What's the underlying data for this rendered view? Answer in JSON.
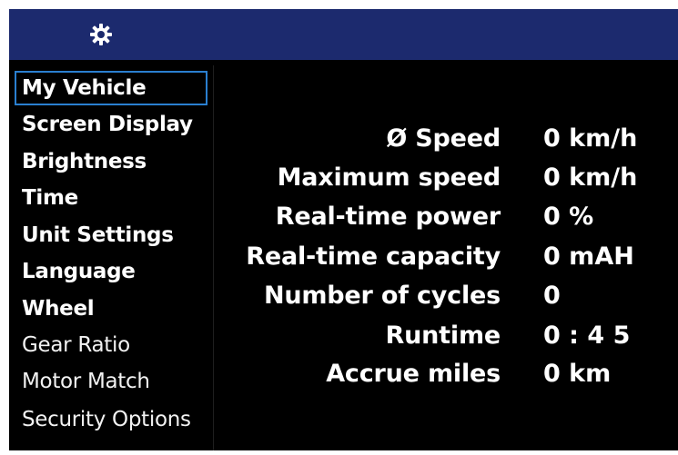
{
  "header": {
    "icon": "gear-icon",
    "color": "#1c2a6e"
  },
  "sidebar": {
    "selected_color": "#2a7fd0",
    "items": [
      {
        "label": "My Vehicle"
      },
      {
        "label": "Screen Display"
      },
      {
        "label": "Brightness"
      },
      {
        "label": "Time"
      },
      {
        "label": "Unit Settings"
      },
      {
        "label": "Language"
      },
      {
        "label": "Wheel"
      },
      {
        "label": "Gear Ratio"
      },
      {
        "label": "Motor Match"
      },
      {
        "label": "Security Options"
      }
    ]
  },
  "stats": [
    {
      "label": "Ø Speed",
      "value": "0 km/h"
    },
    {
      "label": "Maximum speed",
      "value": "0 km/h"
    },
    {
      "label": "Real-time power",
      "value": "0 %"
    },
    {
      "label": "Real-time capacity",
      "value": "0 mAH"
    },
    {
      "label": "Number of cycles",
      "value": "0"
    },
    {
      "label": "Runtime",
      "value": "0 : 4 5"
    },
    {
      "label": "Accrue miles",
      "value": "0 km"
    }
  ]
}
